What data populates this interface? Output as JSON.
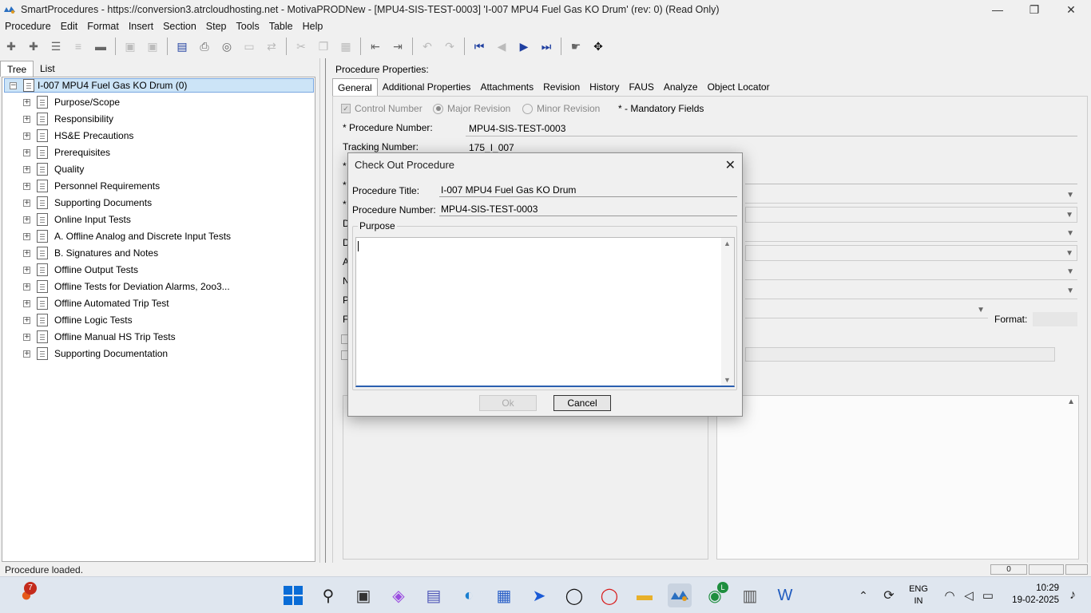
{
  "window": {
    "title": "SmartProcedures - https://conversion3.atrcloudhosting.net - MotivaPRODNew - [MPU4-SIS-TEST-0003] 'I-007 MPU4 Fuel Gas KO Drum' (rev: 0) (Read Only)",
    "minimize": "—",
    "maximize": "❐",
    "close": "✕"
  },
  "menu": [
    "Procedure",
    "Edit",
    "Format",
    "Insert",
    "Section",
    "Step",
    "Tools",
    "Table",
    "Help"
  ],
  "left_tabs": {
    "tree": "Tree",
    "list": "List"
  },
  "tree": {
    "root": "I-007 MPU4 Fuel Gas KO Drum (0)",
    "items": [
      "Purpose/Scope",
      "Responsibility",
      "HS&E Precautions",
      "Prerequisites",
      "Quality",
      "Personnel Requirements",
      "Supporting Documents",
      "Online Input Tests",
      "A. Offline Analog and Discrete Input Tests",
      "B. Signatures and Notes",
      "Offline Output Tests",
      "Offline Tests for Deviation Alarms, 2oo3...",
      "Offline Automated Trip Test",
      "Offline Logic Tests",
      "Offline Manual HS Trip Tests",
      "Supporting Documentation"
    ]
  },
  "properties": {
    "heading": "Procedure Properties:",
    "tabs": [
      "General",
      "Additional Properties",
      "Attachments",
      "Revision",
      "History",
      "FAUS",
      "Analyze",
      "Object Locator"
    ],
    "control_number": "Control Number",
    "major_revision": "Major Revision",
    "minor_revision": "Minor Revision",
    "mandatory": "* - Mandatory Fields",
    "proc_number_label": "* Procedure Number:",
    "proc_number_value": "MPU4-SIS-TEST-0003",
    "tracking_label": "Tracking Number:",
    "tracking_value": "175_I_007",
    "format_label": "Format:",
    "clipped_labels": [
      "*",
      "*",
      "*",
      "D",
      "D",
      "A",
      "N",
      "P",
      "F"
    ]
  },
  "dialog": {
    "title": "Check Out Procedure",
    "close": "✕",
    "title_label": "Procedure Title:",
    "title_value": "I-007 MPU4 Fuel Gas KO Drum",
    "number_label": "Procedure Number:",
    "number_value": "MPU4-SIS-TEST-0003",
    "purpose_label": "Purpose",
    "purpose_value": "",
    "ok": "Ok",
    "cancel": "Cancel"
  },
  "status": "Procedure loaded.",
  "page_indicator": "0",
  "taskbar": {
    "notification_count": "7",
    "lang1": "ENG",
    "lang2": "IN",
    "time": "10:29",
    "date": "19-02-2025",
    "chrome_badge": "L"
  },
  "colors": {
    "selection": "#cce4f7",
    "taskbar": "#dfe6ef",
    "accent": "#2b5fb0"
  }
}
